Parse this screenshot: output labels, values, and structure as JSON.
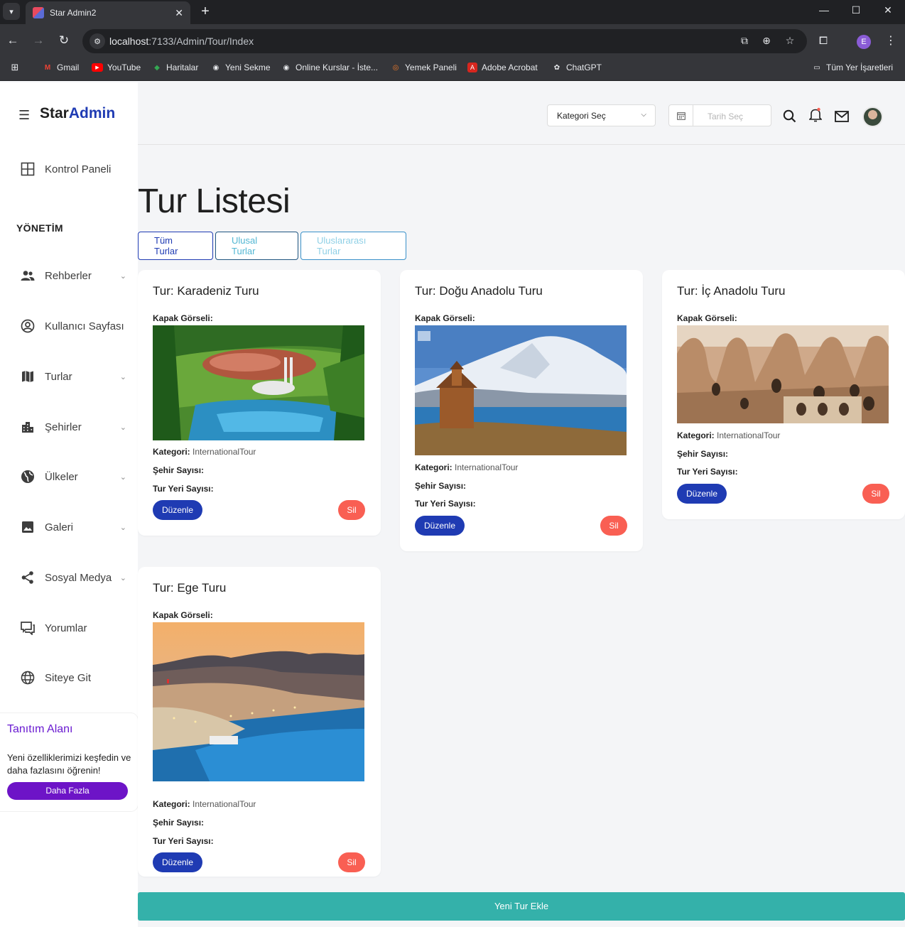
{
  "browser": {
    "tab_title": "Star Admin2",
    "url_host": "localhost",
    "url_path": ":7133/Admin/Tour/Index",
    "bookmarks": [
      "Gmail",
      "YouTube",
      "Haritalar",
      "Yeni Sekme",
      "Online Kurslar - İste...",
      "Yemek Paneli",
      "Adobe Acrobat",
      "ChatGPT"
    ],
    "all_bookmarks": "Tüm Yer İşaretleri",
    "profile_initial": "E"
  },
  "brand": {
    "part1": "Star",
    "part2": "Admin"
  },
  "topnav": {
    "category_select": "Kategori Seç",
    "date_placeholder": "Tarih Seç"
  },
  "sidebar": {
    "dashboard": "Kontrol Paneli",
    "section": "YÖNETİM",
    "items": [
      {
        "label": "Rehberler",
        "icon": "people-icon",
        "has_chevron": true
      },
      {
        "label": "Kullanıcı Sayfası",
        "icon": "user-circle-icon",
        "has_chevron": false
      },
      {
        "label": "Turlar",
        "icon": "map-icon",
        "has_chevron": true
      },
      {
        "label": "Şehirler",
        "icon": "city-icon",
        "has_chevron": true
      },
      {
        "label": "Ülkeler",
        "icon": "globe-icon",
        "has_chevron": true
      },
      {
        "label": "Galeri",
        "icon": "image-icon",
        "has_chevron": true
      },
      {
        "label": "Sosyal Medya",
        "icon": "share-icon",
        "has_chevron": true
      },
      {
        "label": "Yorumlar",
        "icon": "comments-icon",
        "has_chevron": false
      },
      {
        "label": "Siteye Git",
        "icon": "web-icon",
        "has_chevron": false
      }
    ],
    "promo": {
      "title": "Tanıtım Alanı",
      "text": "Yeni özelliklerimizi keşfedin ve daha fazlasını öğrenin!",
      "button": "Daha Fazla"
    }
  },
  "page": {
    "title": "Tur Listesi",
    "filters": [
      "Tüm Turlar",
      "Ulusal Turlar",
      "Uluslararası Turlar"
    ],
    "add_button": "Yeni Tur Ekle"
  },
  "labels": {
    "cover": "Kapak Görseli:",
    "category": "Kategori:",
    "city_count": "Şehir Sayısı:",
    "place_count": "Tur Yeri Sayısı:",
    "edit": "Düzenle",
    "delete": "Sil"
  },
  "tours": [
    {
      "title": "Tur: Karadeniz Turu",
      "category": "InternationalTour",
      "city_count": "",
      "place_count": ""
    },
    {
      "title": "Tur: Doğu Anadolu Turu",
      "category": "InternationalTour",
      "city_count": "",
      "place_count": ""
    },
    {
      "title": "Tur: İç Anadolu Turu",
      "category": "InternationalTour",
      "city_count": "",
      "place_count": ""
    },
    {
      "title": "Tur: Ege Turu",
      "category": "InternationalTour",
      "city_count": "",
      "place_count": ""
    }
  ],
  "colors": {
    "brand_accent": "#1f3bb3",
    "delete": "#f95f53",
    "add": "#34b1aa",
    "promo": "#6d14c7"
  }
}
